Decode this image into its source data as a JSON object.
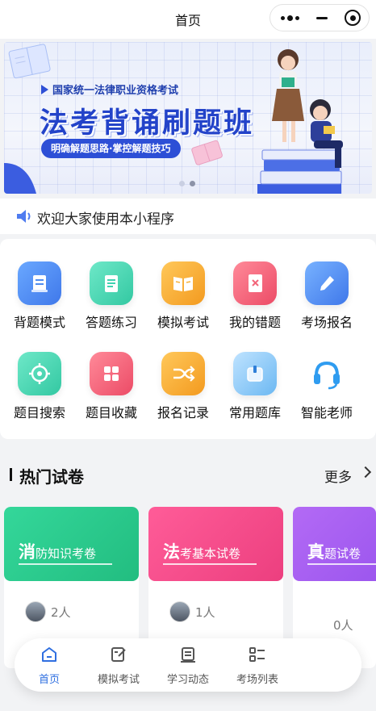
{
  "navbar": {
    "title": "首页"
  },
  "banner": {
    "subtitle": "国家统一法律职业资格考试",
    "title": "法考背诵刷题班",
    "tag": "明确解题思路·掌控解题技巧"
  },
  "notice": {
    "text": "欢迎大家使用本小程序"
  },
  "menu": [
    {
      "label": "背题模式",
      "icon": "scroll-icon",
      "color": "#4f8df0"
    },
    {
      "label": "答题练习",
      "icon": "notepad-icon",
      "color": "#3fd2b0"
    },
    {
      "label": "模拟考试",
      "icon": "open-book-icon",
      "color": "#f6b13a"
    },
    {
      "label": "我的错题",
      "icon": "wrong-doc-icon",
      "color": "#f2667a"
    },
    {
      "label": "考场报名",
      "icon": "pen-icon",
      "color": "#4f8df0"
    },
    {
      "label": "题目搜索",
      "icon": "crosshair-icon",
      "color": "#3fd2b0"
    },
    {
      "label": "题目收藏",
      "icon": "grid-icon",
      "color": "#f2667a"
    },
    {
      "label": "报名记录",
      "icon": "shuffle-icon",
      "color": "#f6b13a"
    },
    {
      "label": "常用题库",
      "icon": "box-icon",
      "color": "#5db4ef"
    },
    {
      "label": "智能老师",
      "icon": "headset-icon",
      "color": "#2f9cf0"
    }
  ],
  "hot": {
    "title": "热门试卷",
    "more": "更多",
    "papers": [
      {
        "first": "消",
        "rest": "防知识考卷",
        "users": "2人",
        "color": "#2cc98a"
      },
      {
        "first": "法",
        "rest": "考基本试卷",
        "users": "1人",
        "color": "#f24d8c"
      },
      {
        "first": "真",
        "rest": "题试卷",
        "users": "0人",
        "color": "#a55ef0"
      }
    ]
  },
  "tabbar": [
    {
      "label": "首页",
      "icon": "home-icon"
    },
    {
      "label": "模拟考试",
      "icon": "edit-doc-icon"
    },
    {
      "label": "学习动态",
      "icon": "doc-lines-icon"
    },
    {
      "label": "考场列表",
      "icon": "list-icon"
    }
  ]
}
